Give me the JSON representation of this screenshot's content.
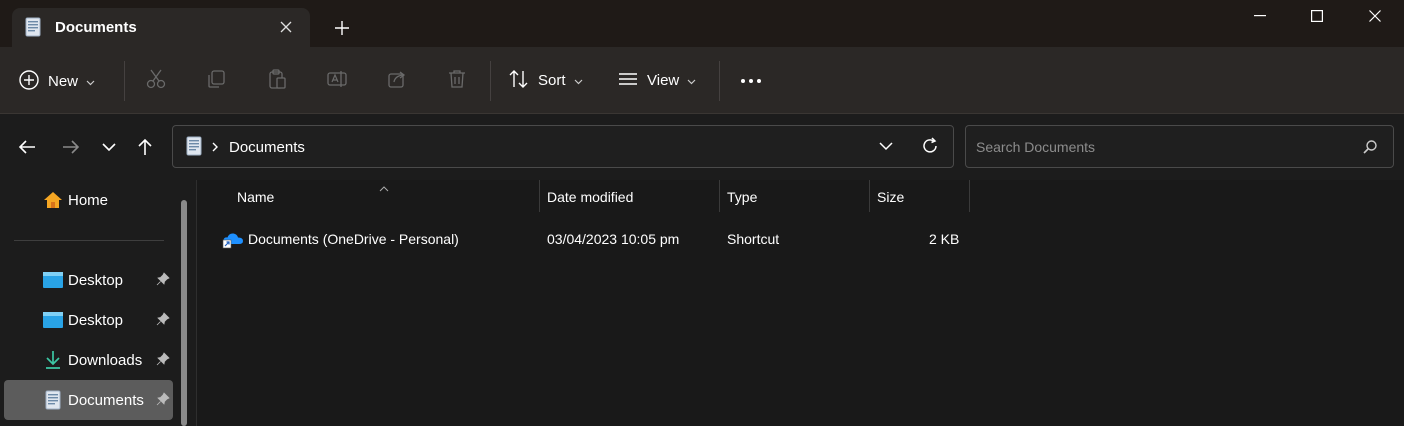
{
  "window": {
    "tab_title": "Documents",
    "new_tab_glyph": "+"
  },
  "toolbar": {
    "new_label": "New",
    "sort_label": "Sort",
    "view_label": "View",
    "icons": [
      "cut-icon",
      "copy-icon",
      "paste-icon",
      "rename-icon",
      "share-icon",
      "delete-icon"
    ]
  },
  "address": {
    "crumb": "Documents"
  },
  "search": {
    "placeholder": "Search Documents"
  },
  "sidebar": {
    "items": [
      {
        "label": "Home"
      },
      {
        "label": "Desktop"
      },
      {
        "label": "Desktop"
      },
      {
        "label": "Downloads"
      },
      {
        "label": "Documents"
      }
    ]
  },
  "columns": {
    "name": "Name",
    "date": "Date modified",
    "type": "Type",
    "size": "Size"
  },
  "files": [
    {
      "name": "Documents (OneDrive - Personal)",
      "date": "03/04/2023 10:05 pm",
      "type": "Shortcut",
      "size": "2 KB"
    }
  ],
  "colors": {
    "accent_cloud": "#1e90ff",
    "selected_bg": "#5c5c5c",
    "home_icon": "#f5a623"
  }
}
